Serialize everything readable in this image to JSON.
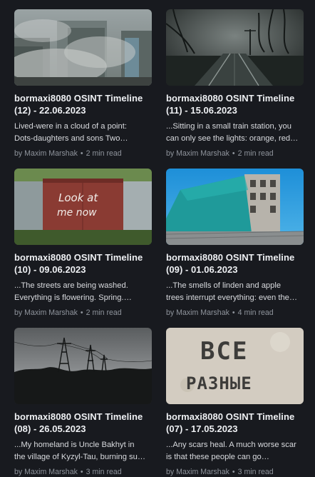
{
  "posts": [
    {
      "title_line1": "bormaxi8080 OSINT Timeline",
      "title_line2": "(12) - 22.06.2023",
      "excerpt_line1": "Lived-were in a cloud of a point:",
      "excerpt_line2": "Dots-daughters and sons Two…",
      "author": "by Maxim Marshak",
      "read_time": "2 min read",
      "image": "ruined-buildings-smoke"
    },
    {
      "title_line1": "bormaxi8080 OSINT Timeline",
      "title_line2": "(11) - 15.06.2023",
      "excerpt_line1": "...Sitting in a small train station, you",
      "excerpt_line2": "can only see the lights: orange, red…",
      "author": "by Maxim Marshak",
      "read_time": "2 min read",
      "image": "railway-tracks-night"
    },
    {
      "title_line1": "bormaxi8080 OSINT Timeline",
      "title_line2": "(10) - 09.06.2023",
      "excerpt_line1": "...The streets are being washed.",
      "excerpt_line2": "Everything is flowering. Spring.…",
      "author": "by Maxim Marshak",
      "read_time": "2 min read",
      "image": "graffiti-garage",
      "graffiti_text_1": "Look at",
      "graffiti_text_2": "me now"
    },
    {
      "title_line1": "bormaxi8080 OSINT Timeline",
      "title_line2": "(09) - 01.06.2023",
      "excerpt_line1": "...The smells of linden and apple",
      "excerpt_line2": "trees interrupt everything: even the…",
      "author": "by Maxim Marshak",
      "read_time": "4 min read",
      "image": "abandoned-building-blue-sky"
    },
    {
      "title_line1": "bormaxi8080 OSINT Timeline",
      "title_line2": "(08) - 26.05.2023",
      "excerpt_line1": "...My homeland is Uncle Bakhyt in",
      "excerpt_line2": "the village of Kyzyl-Tau, burning su…",
      "author": "by Maxim Marshak",
      "read_time": "3 min read",
      "image": "power-lines-dusk"
    },
    {
      "title_line1": "bormaxi8080 OSINT Timeline",
      "title_line2": "(07) - 17.05.2023",
      "excerpt_line1": "...Any scars heal. A much worse scar",
      "excerpt_line2": "is that these people can go…",
      "author": "by Maxim Marshak",
      "read_time": "3 min read",
      "image": "wall-inscription",
      "wall_text_1": "ВСЕ",
      "wall_text_2": "РАЗНЫЕ"
    }
  ],
  "separator": "•"
}
